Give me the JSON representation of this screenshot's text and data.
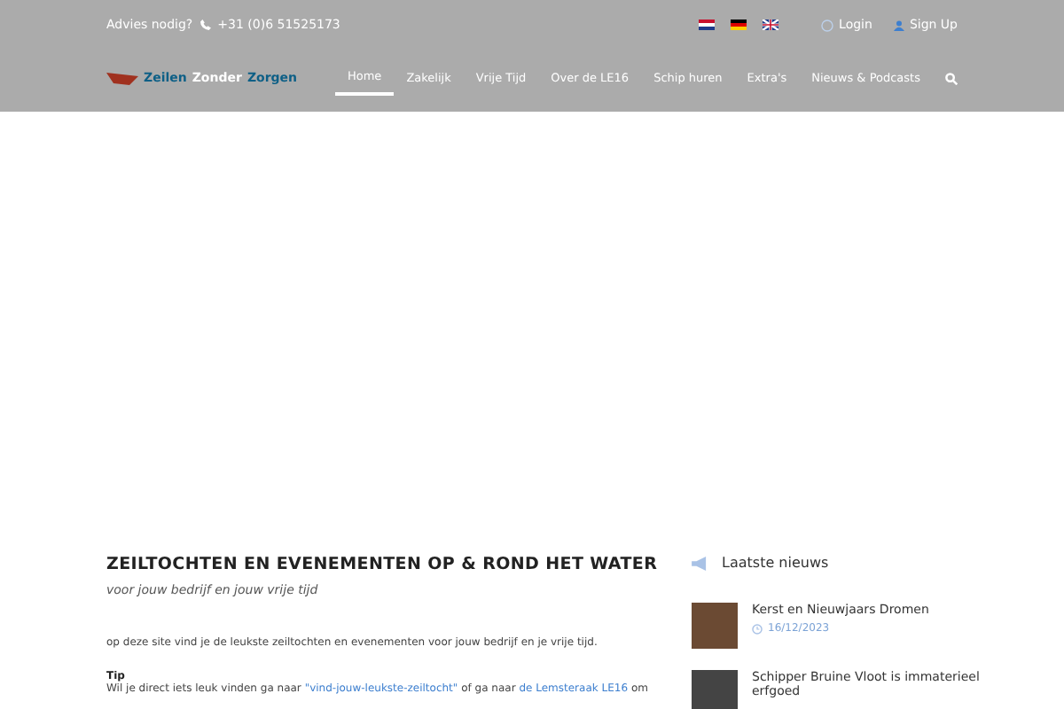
{
  "topbar": {
    "advice": "Advies nodig?",
    "phone": "+31 (0)6 51525173",
    "languages": [
      {
        "kind": "nl"
      },
      {
        "kind": "de"
      },
      {
        "kind": "en"
      }
    ],
    "login": "Login",
    "signup": "Sign Up"
  },
  "logo": {
    "parts": [
      "Zeilen",
      "Zonder",
      "Zorgen"
    ]
  },
  "nav": {
    "items": [
      {
        "label": "Home",
        "selected": true
      },
      {
        "label": "Zakelijk",
        "selected": false
      },
      {
        "label": "Vrije Tijd",
        "selected": false
      },
      {
        "label": "Over de LE16",
        "selected": false
      },
      {
        "label": "Schip huren",
        "selected": false
      },
      {
        "label": "Extra's",
        "selected": false
      },
      {
        "label": "Nieuws & Podcasts",
        "selected": false
      }
    ]
  },
  "main": {
    "title": "ZEILTOCHTEN EN EVENEMENTEN OP & ROND HET WATER",
    "subtitle": "voor jouw bedrijf en jouw vrije tijd",
    "intro": "op deze site vind je de leukste zeiltochten en evenementen voor jouw bedrijf en je vrije tijd.",
    "tip_label": "Tip",
    "tip_parts": [
      {
        "kind": "text",
        "text": "Wil je direct iets leuk vinden ga naar "
      },
      {
        "kind": "link",
        "text": "\"vind-jouw-leukste-zeiltocht\""
      },
      {
        "kind": "text",
        "text": " of ga naar "
      },
      {
        "kind": "link",
        "text": "de Lemsteraak LE16"
      },
      {
        "kind": "text",
        "text": " om"
      }
    ]
  },
  "news": {
    "title": "Laatste nieuws",
    "items": [
      {
        "title": "Kerst en Nieuwjaars Dromen",
        "date": "16/12/2023"
      },
      {
        "title": "Schipper Bruine Vloot is immaterieel erfgoed"
      }
    ]
  }
}
